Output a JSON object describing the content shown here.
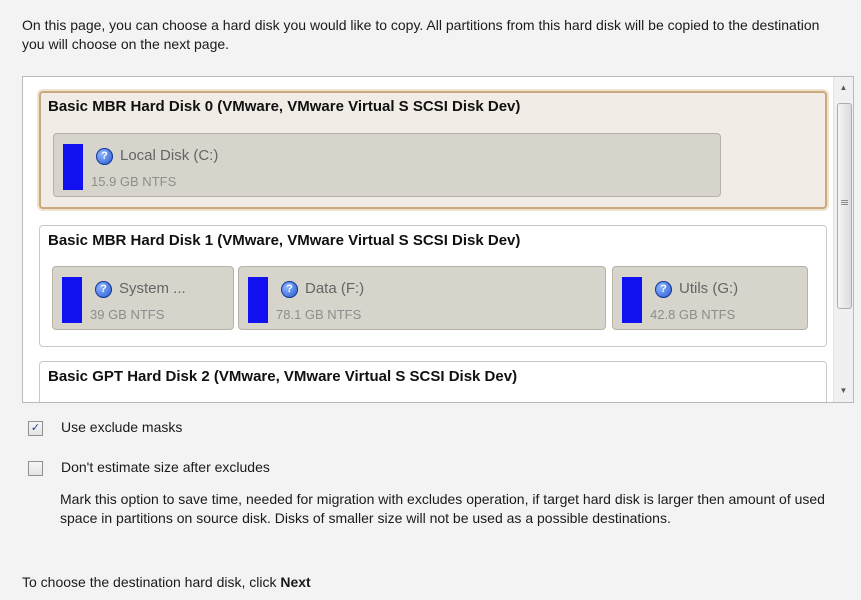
{
  "intro_text": "On this page, you can choose a hard disk you would like to copy. All partitions from this hard disk will be copied to the destination you will choose on the next page.",
  "disks": [
    {
      "title": "Basic MBR Hard Disk 0 (VMware, VMware Virtual S SCSI Disk Dev)",
      "partitions": [
        {
          "name": "Local Disk (C:)",
          "size": "15.9 GB NTFS"
        }
      ]
    },
    {
      "title": "Basic MBR Hard Disk 1 (VMware, VMware Virtual S SCSI Disk Dev)",
      "partitions": [
        {
          "name": "System ...",
          "size": "39 GB NTFS"
        },
        {
          "name": "Data (F:)",
          "size": "78.1 GB NTFS"
        },
        {
          "name": "Utils (G:)",
          "size": "42.8 GB NTFS"
        }
      ]
    },
    {
      "title": "Basic GPT Hard Disk 2 (VMware, VMware Virtual S SCSI Disk Dev)",
      "partitions": []
    }
  ],
  "selected_disk_index": 0,
  "options": {
    "use_exclude_masks": {
      "label": "Use exclude masks",
      "checked": true
    },
    "dont_estimate": {
      "label": "Don't estimate size after excludes",
      "checked": false
    }
  },
  "description_text": "Mark this option to save time, needed for migration with excludes operation, if target hard disk is larger then amount of used space in partitions on source disk. Disks of smaller size will not be used as a possible destinations.",
  "footer": {
    "prefix": "To choose the destination hard disk, click",
    "action": "Next"
  },
  "colors": {
    "partition_bar": "#1010f0",
    "selected_border": "#c8aa7c"
  },
  "icons": {
    "partition": "help-circle-icon",
    "scroll_up": "arrow-up-icon",
    "scroll_down": "arrow-down-icon"
  }
}
